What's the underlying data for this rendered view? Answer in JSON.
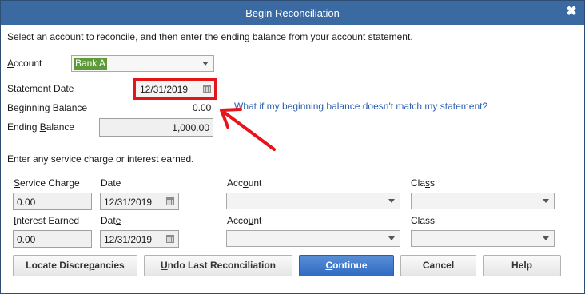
{
  "window": {
    "title": "Begin Reconciliation",
    "close_glyph": "✖"
  },
  "instructions": "Select an account to reconcile, and then enter the ending balance from your account statement.",
  "account": {
    "label_u": "A",
    "label_rest": "ccount",
    "value": "Bank A"
  },
  "statement_date": {
    "label_a": "Statement ",
    "label_u": "D",
    "label_b": "ate",
    "value": "12/31/2019"
  },
  "beginning_balance": {
    "label": "Beginning Balance",
    "value": "0.00"
  },
  "help_link": "What if my beginning balance doesn't match my statement?",
  "ending_balance": {
    "label_a": "Ending ",
    "label_u": "B",
    "label_b": "alance",
    "value": "1,000.00"
  },
  "service_prompt": "Enter any service charge or interest earned.",
  "service_charge": {
    "label_u": "S",
    "label_rest": "ervice Charge",
    "value": "0.00",
    "date_label_a": "Date",
    "date_value": "12/31/2019",
    "account_label_a": "Acc",
    "account_label_u": "o",
    "account_label_b": "unt",
    "class_label_a": "Cla",
    "class_label_u": "s",
    "class_label_b": "s"
  },
  "interest_earned": {
    "label_u": "I",
    "label_rest": "nterest Earned",
    "value": "0.00",
    "date_label_a": "Dat",
    "date_label_u": "e",
    "date_value": "12/31/2019",
    "account_label_a": "Acco",
    "account_label_u": "u",
    "account_label_b": "nt",
    "class_label_a": "Class"
  },
  "buttons": {
    "locate_a": "Locate Discre",
    "locate_u": "p",
    "locate_b": "ancies",
    "undo_u": "U",
    "undo_rest": "ndo Last Reconciliation",
    "continue_u": "C",
    "continue_rest": "ontinue",
    "cancel": "Cancel",
    "help": "Help"
  },
  "colors": {
    "title_bar": "#3b6aa3",
    "highlight_annotation": "#e8141b",
    "account_selected_bg": "#5e9b38",
    "link": "#2a5fb0"
  }
}
